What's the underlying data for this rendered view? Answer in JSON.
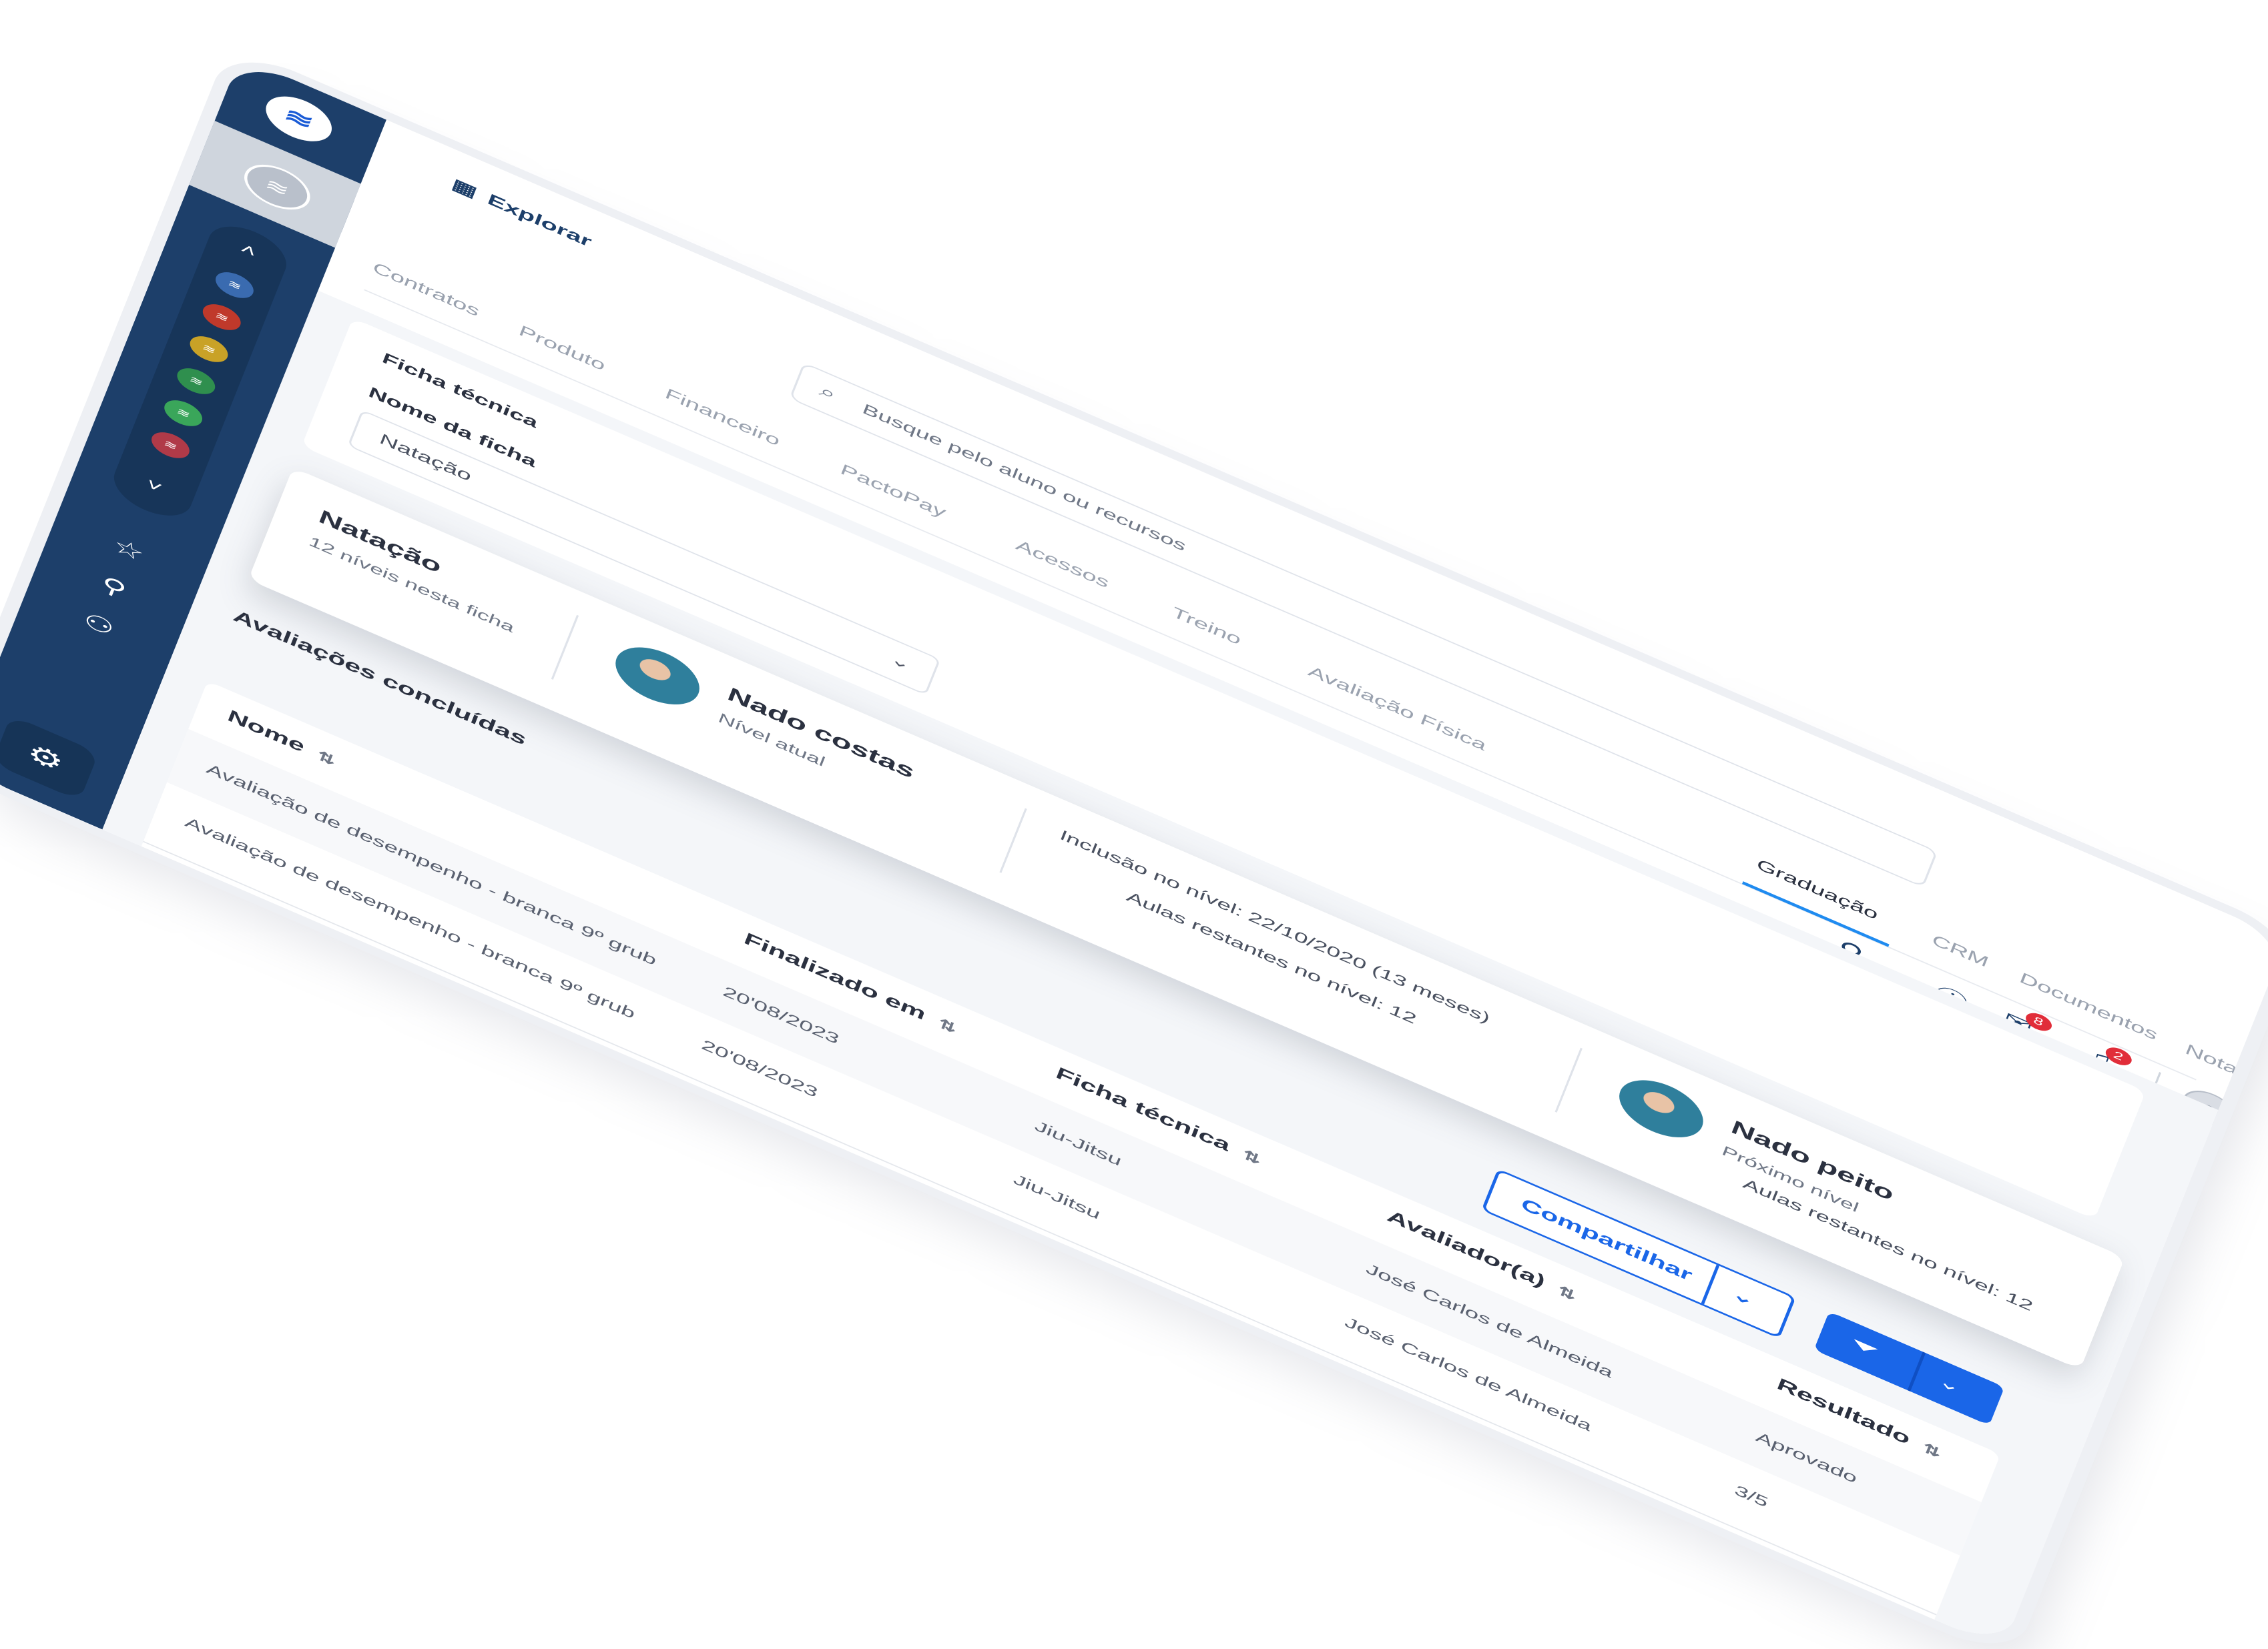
{
  "nav": {
    "explorar": "Explorar"
  },
  "search": {
    "placeholder": "Busque pelo aluno ou recursos"
  },
  "header": {
    "chat_badge": "8",
    "notif_badge": "2"
  },
  "tabs": [
    "Contratos",
    "Produto",
    "Financeiro",
    "PactoPay",
    "Acessos",
    "Treino",
    "Avaliação Física",
    "Graduação",
    "CRM",
    "Documentos",
    "Notas fiscais"
  ],
  "active_tab": "Graduação",
  "ficha": {
    "title": "Ficha técnica",
    "nome_label": "Nome da ficha",
    "selected": "Natação"
  },
  "level_card": {
    "title": "Natação",
    "subtitle": "12 níveis nesta ficha",
    "current": {
      "name": "Nado costas",
      "label": "Nível atual"
    },
    "inclusion": "Inclusão no nível: 22/10/2020 (13 meses)",
    "remaining_current": "Aulas restantes no nível: 12",
    "next": {
      "name": "Nado peito",
      "label": "Próximo nível"
    },
    "remaining_next": "Aulas restantes no nível: 12"
  },
  "avaliacoes": {
    "title": "Avaliações concluídas",
    "share_label": "Compartilhar",
    "columns": [
      "Nome",
      "Finalizado em",
      "Ficha técnica",
      "Avaliador(a)",
      "Resultado"
    ],
    "rows": [
      [
        "Avaliação de desempenho - branca 9º grub",
        "20'08/2023",
        "Jiu-Jitsu",
        "José Carlos de Almeida",
        "Aprovado"
      ],
      [
        "Avaliação de desempenho - branca 9º grub",
        "20'08/2023",
        "Jiu-Jitsu",
        "José Carlos de Almeida",
        "3/5"
      ]
    ]
  },
  "colors": {
    "sidebar": "#1d3f6a",
    "accent": "#1a66e8",
    "tab_indicator": "#1f8bf0",
    "badge": "#e12d39"
  },
  "icons": [
    "logo-icon",
    "unit-logo-icon",
    "chevron-right-icon",
    "chevron-up-icon",
    "chevron-down-icon",
    "star-icon",
    "add-user-icon",
    "users-icon",
    "gear-icon",
    "grid-icon",
    "search-icon",
    "help-icon",
    "chat-icon",
    "bell-icon",
    "user-avatar-icon",
    "filter-icon",
    "sort-icon"
  ]
}
